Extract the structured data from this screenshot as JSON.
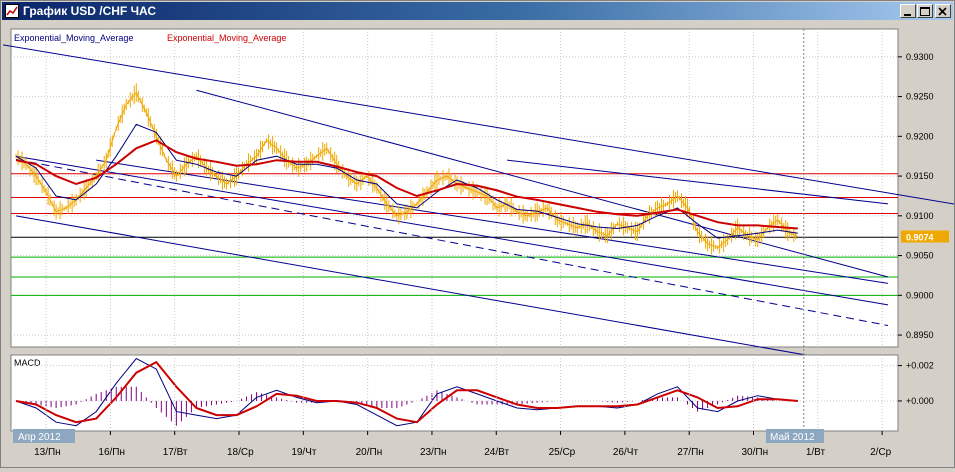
{
  "window": {
    "title": "График USD /CHF ЧАС"
  },
  "legend": {
    "ema1": "Exponential_Moving_Average",
    "ema2": "Exponential_Moving_Average"
  },
  "colors": {
    "price": "#f0a800",
    "ema_fast": "#000080",
    "ema_slow": "#cc0000",
    "channel": "#000090",
    "red_levels": "#e00000",
    "green_levels": "#00b000",
    "current_line": "#000000",
    "price_label_bg": "#f0a800",
    "macd_hist": "#800080"
  },
  "macd": {
    "label": "MACD",
    "tick_labels": [
      "+0.002",
      "+0.000"
    ]
  },
  "period": {
    "start_label": "Апр 2012",
    "end_label": "Май 2012"
  },
  "chart_data": [
    {
      "type": "line",
      "panel": "price",
      "y_ticks": [
        0.93,
        0.925,
        0.92,
        0.915,
        0.91,
        0.905,
        0.9,
        0.895
      ],
      "y_tick_labels": [
        "0.9300",
        "0.9250",
        "0.9200",
        "0.9150",
        "0.9100",
        "0.9050",
        "0.9000",
        "0.8950"
      ],
      "ylim": [
        0.8935,
        0.9335
      ],
      "x_tick_labels": [
        "13/Пн",
        "16/Пн",
        "17/Вт",
        "18/Ср",
        "19/Чт",
        "20/Пн",
        "23/Пн",
        "24/Вт",
        "25/Ср",
        "26/Чт",
        "27/Пн",
        "30/Пн",
        "1/Вт",
        "2/Ср"
      ],
      "last_price": 0.9074,
      "last_price_label": "0.9074",
      "price_series": {
        "x": [
          0,
          2,
          4,
          6,
          8,
          10,
          12,
          14,
          16,
          18,
          20,
          22,
          24,
          26,
          28,
          30,
          32,
          34,
          36,
          38,
          40,
          42,
          44,
          46,
          48,
          50,
          52,
          54,
          56,
          58,
          60,
          62,
          64,
          66,
          68,
          70,
          72,
          74,
          76,
          78,
          80,
          82,
          84,
          86,
          88,
          90,
          92,
          94,
          96,
          98,
          100,
          102,
          104,
          106,
          108,
          110,
          112,
          114,
          116,
          118,
          120,
          122,
          124,
          126,
          128,
          130,
          132,
          134,
          136,
          138,
          140,
          142,
          144,
          146,
          148,
          150,
          152,
          154,
          156
        ],
        "y": [
          0.9175,
          0.9165,
          0.915,
          0.913,
          0.9105,
          0.911,
          0.912,
          0.9135,
          0.915,
          0.917,
          0.921,
          0.924,
          0.9255,
          0.923,
          0.92,
          0.917,
          0.915,
          0.9165,
          0.9175,
          0.916,
          0.915,
          0.914,
          0.915,
          0.9165,
          0.9175,
          0.9195,
          0.9185,
          0.917,
          0.916,
          0.9165,
          0.9175,
          0.9185,
          0.9165,
          0.915,
          0.914,
          0.915,
          0.9135,
          0.9115,
          0.91,
          0.9105,
          0.9115,
          0.913,
          0.9145,
          0.915,
          0.914,
          0.9135,
          0.913,
          0.9125,
          0.911,
          0.9115,
          0.9105,
          0.91,
          0.9105,
          0.911,
          0.9095,
          0.909,
          0.9085,
          0.909,
          0.908,
          0.9075,
          0.909,
          0.9085,
          0.908,
          0.91,
          0.911,
          0.9115,
          0.9125,
          0.911,
          0.908,
          0.9065,
          0.906,
          0.907,
          0.9085,
          0.9075,
          0.907,
          0.9085,
          0.9095,
          0.908,
          0.9074
        ]
      },
      "series": [
        {
          "style": "ema_fast",
          "x": [
            0,
            4,
            8,
            12,
            16,
            20,
            24,
            28,
            32,
            36,
            40,
            44,
            48,
            52,
            56,
            60,
            64,
            68,
            72,
            76,
            80,
            84,
            88,
            92,
            96,
            100,
            104,
            108,
            112,
            116,
            120,
            124,
            128,
            132,
            136,
            140,
            144,
            148,
            152,
            156
          ],
          "y": [
            0.9175,
            0.916,
            0.9125,
            0.912,
            0.914,
            0.9175,
            0.9215,
            0.9205,
            0.917,
            0.9165,
            0.9155,
            0.915,
            0.917,
            0.9175,
            0.9165,
            0.9165,
            0.916,
            0.9145,
            0.914,
            0.9115,
            0.911,
            0.913,
            0.9145,
            0.9135,
            0.912,
            0.9108,
            0.9106,
            0.9098,
            0.909,
            0.9086,
            0.9084,
            0.9088,
            0.91,
            0.911,
            0.909,
            0.9072,
            0.9075,
            0.9078,
            0.9082,
            0.9078
          ]
        },
        {
          "style": "ema_slow",
          "x": [
            0,
            4,
            8,
            12,
            16,
            20,
            24,
            28,
            32,
            36,
            40,
            44,
            48,
            52,
            56,
            60,
            64,
            68,
            72,
            76,
            80,
            84,
            88,
            92,
            96,
            100,
            104,
            108,
            112,
            116,
            120,
            124,
            128,
            132,
            136,
            140,
            144,
            148,
            152,
            156
          ],
          "y": [
            0.917,
            0.9165,
            0.915,
            0.914,
            0.9148,
            0.9165,
            0.9185,
            0.9195,
            0.918,
            0.9172,
            0.9168,
            0.9163,
            0.9165,
            0.917,
            0.9168,
            0.9168,
            0.9162,
            0.9155,
            0.915,
            0.9135,
            0.9125,
            0.9132,
            0.914,
            0.9138,
            0.9132,
            0.9124,
            0.912,
            0.9115,
            0.911,
            0.9105,
            0.9102,
            0.91,
            0.9104,
            0.9108,
            0.91,
            0.9092,
            0.9088,
            0.9088,
            0.9086,
            0.9084
          ]
        }
      ],
      "levels_red": [
        0.9153,
        0.9123,
        0.9103
      ],
      "level_current": 0.9073,
      "levels_green": [
        0.9048,
        0.9023,
        0.9
      ],
      "channel_lines": [
        {
          "x": [
            -12,
            188
          ],
          "y": [
            0.9325,
            0.9114
          ],
          "dash": false
        },
        {
          "x": [
            36,
            174
          ],
          "y": [
            0.9258,
            0.9023
          ],
          "dash": false
        },
        {
          "x": [
            0,
            174
          ],
          "y": [
            0.9171,
            0.8962
          ],
          "dash": true
        },
        {
          "x": [
            16,
            174
          ],
          "y": [
            0.917,
            0.9015
          ],
          "dash": false
        },
        {
          "x": [
            0,
            174
          ],
          "y": [
            0.9175,
            0.8988
          ],
          "dash": false
        },
        {
          "x": [
            98,
            174
          ],
          "y": [
            0.917,
            0.9115
          ],
          "dash": false
        },
        {
          "x": [
            0,
            162
          ],
          "y": [
            0.91,
            0.892
          ],
          "dash": false
        }
      ],
      "x_range": [
        -1,
        176
      ]
    },
    {
      "type": "line",
      "panel": "macd",
      "ylim": [
        -0.0017,
        0.0026
      ],
      "y_ticks": [
        0.002,
        0.0
      ],
      "x": [
        0,
        4,
        8,
        12,
        16,
        20,
        24,
        28,
        32,
        36,
        40,
        44,
        48,
        52,
        56,
        60,
        64,
        68,
        72,
        76,
        80,
        84,
        88,
        92,
        96,
        100,
        104,
        108,
        112,
        116,
        120,
        124,
        128,
        132,
        136,
        140,
        144,
        148,
        152,
        156
      ],
      "series": [
        {
          "style": "macd_line",
          "values": [
            0.0,
            -0.0004,
            -0.0012,
            -0.0014,
            -0.0006,
            0.001,
            0.0024,
            0.0018,
            -0.0006,
            -0.0008,
            -0.001,
            -0.0008,
            0.0002,
            0.0006,
            0.0002,
            -0.0001,
            0.0,
            -0.0002,
            -0.0008,
            -0.0014,
            -0.0012,
            0.0004,
            0.0008,
            0.0004,
            0.0,
            -0.0004,
            -0.0005,
            -0.0004,
            -0.0003,
            -0.0003,
            -0.0004,
            -0.0002,
            0.0004,
            0.0008,
            -0.0004,
            -0.0006,
            0.0,
            0.0003,
            0.0001,
            0.0
          ]
        },
        {
          "style": "signal_line",
          "values": [
            0.0,
            -0.0002,
            -0.0008,
            -0.0012,
            -0.001,
            0.0002,
            0.0016,
            0.0022,
            0.0008,
            -0.0004,
            -0.0008,
            -0.0008,
            -0.0003,
            0.0004,
            0.0003,
            0.0,
            0.0,
            -0.0001,
            -0.0004,
            -0.001,
            -0.0012,
            -0.0002,
            0.0006,
            0.0006,
            0.0002,
            -0.0002,
            -0.0004,
            -0.0004,
            -0.0003,
            -0.0003,
            -0.0003,
            -0.0002,
            0.0002,
            0.0006,
            0.0002,
            -0.0004,
            -0.0003,
            0.0001,
            0.0001,
            0.0
          ]
        }
      ],
      "histogram": [
        0.0,
        -0.0002,
        -0.0004,
        -0.0002,
        0.0004,
        0.0008,
        0.0008,
        -0.0004,
        -0.0014,
        -0.0004,
        -0.0002,
        0.0,
        0.0005,
        0.0002,
        -0.0001,
        -0.0001,
        0.0,
        -0.0001,
        -0.0004,
        -0.0004,
        0.0,
        0.0006,
        0.0002,
        -0.0002,
        -0.0002,
        -0.0002,
        -0.0001,
        0.0,
        0.0,
        0.0,
        -0.0001,
        0.0,
        0.0002,
        0.0002,
        -0.0006,
        -0.0002,
        0.0003,
        0.0002,
        0.0,
        0.0
      ]
    }
  ]
}
